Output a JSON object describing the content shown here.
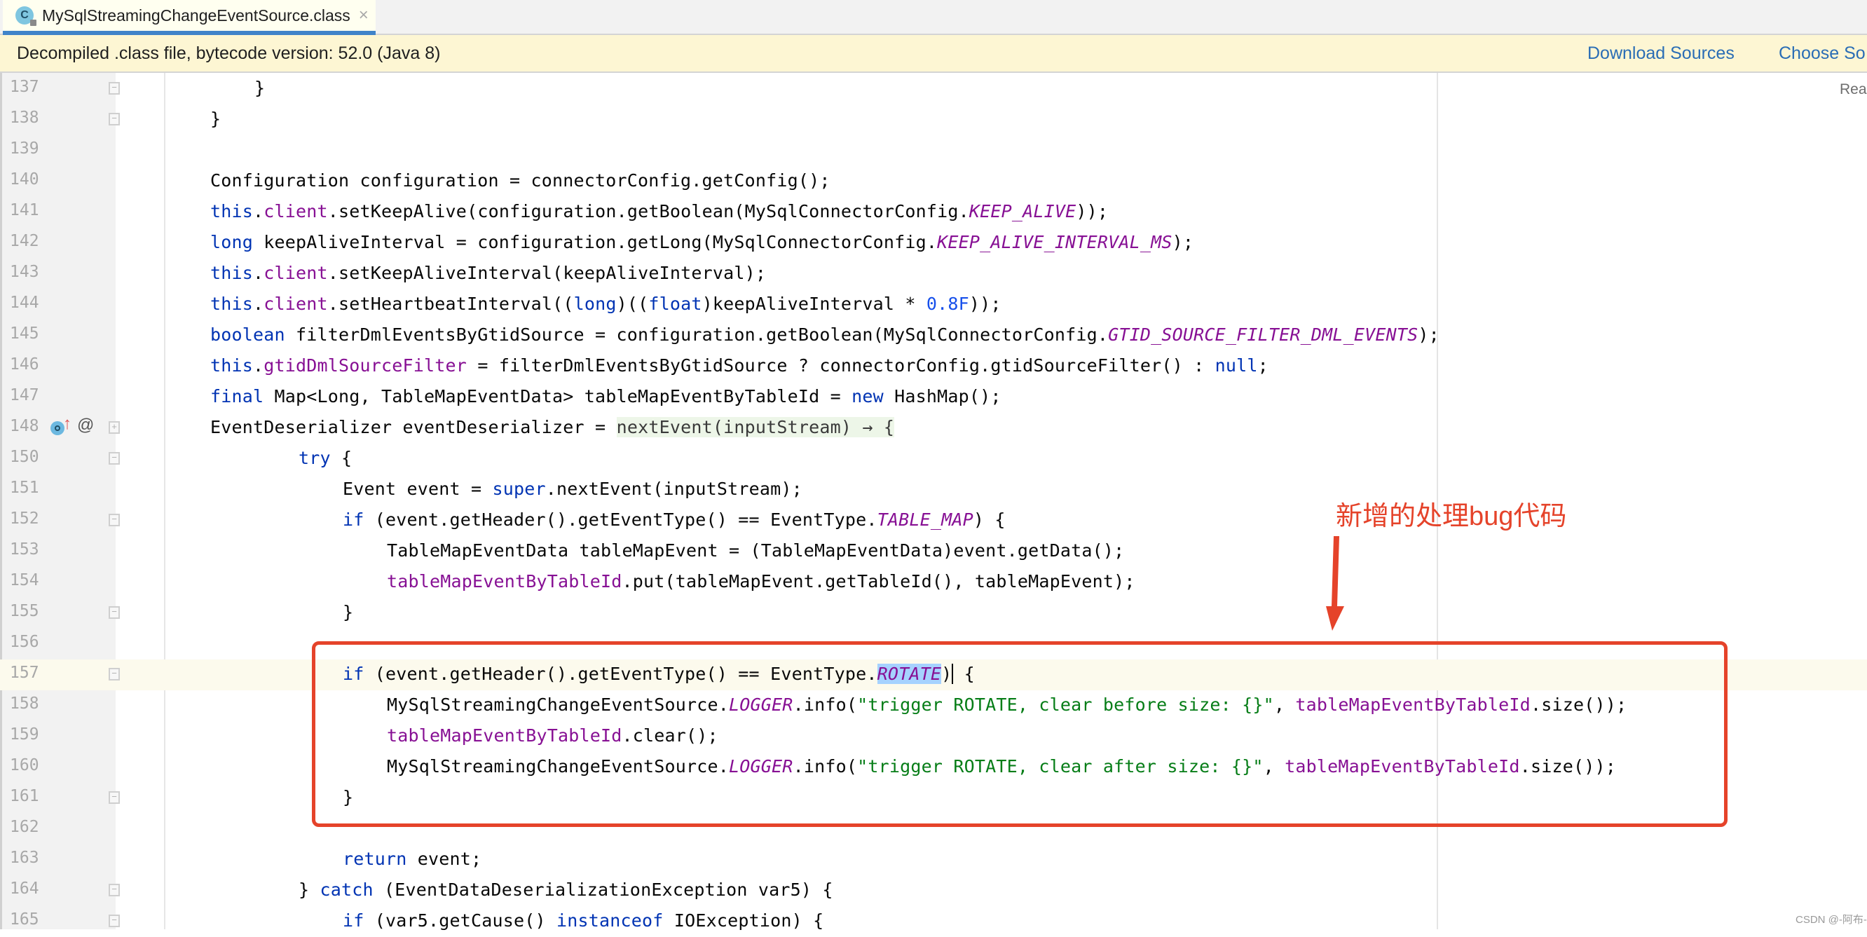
{
  "tab": {
    "icon": "class-file-icon",
    "icon_letter": "C",
    "label": "MySqlStreamingChangeEventSource.class",
    "close_glyph": "×"
  },
  "banner": {
    "text": "Decompiled .class file, bytecode version: 52.0 (Java 8)",
    "download_sources": "Download Sources",
    "choose_sources": "Choose So"
  },
  "reader_mode": "Rea",
  "gutter_icons": {
    "line_148": [
      "implementing-method-icon",
      "override-up-arrow-icon",
      "annotation-at-icon"
    ],
    "at_glyph": "@",
    "up_glyph": "↑"
  },
  "lines": [
    {
      "n": "137",
      "fold": "end",
      "indent": 2,
      "tokens": [
        [
          "}",
          ""
        ]
      ]
    },
    {
      "n": "138",
      "fold": "end",
      "indent": 1,
      "tokens": [
        [
          "}",
          ""
        ]
      ]
    },
    {
      "n": "139",
      "indent": 0,
      "tokens": []
    },
    {
      "n": "140",
      "indent": 1,
      "tokens": [
        [
          "Configuration configuration = connectorConfig.getConfig();",
          ""
        ]
      ]
    },
    {
      "n": "141",
      "indent": 1,
      "tokens": [
        [
          "this",
          "kw"
        ],
        [
          ".",
          ""
        ],
        [
          "client",
          "fld"
        ],
        [
          ".setKeepAlive(configuration.getBoolean(MySqlConnectorConfig.",
          ""
        ],
        [
          "KEEP_ALIVE",
          "cst"
        ],
        [
          "));",
          ""
        ]
      ]
    },
    {
      "n": "142",
      "indent": 1,
      "tokens": [
        [
          "long",
          "kw"
        ],
        [
          " keepAliveInterval = configuration.getLong(MySqlConnectorConfig.",
          ""
        ],
        [
          "KEEP_ALIVE_INTERVAL_MS",
          "cst"
        ],
        [
          ");",
          ""
        ]
      ]
    },
    {
      "n": "143",
      "indent": 1,
      "tokens": [
        [
          "this",
          "kw"
        ],
        [
          ".",
          ""
        ],
        [
          "client",
          "fld"
        ],
        [
          ".setKeepAliveInterval(keepAliveInterval);",
          ""
        ]
      ]
    },
    {
      "n": "144",
      "indent": 1,
      "tokens": [
        [
          "this",
          "kw"
        ],
        [
          ".",
          ""
        ],
        [
          "client",
          "fld"
        ],
        [
          ".setHeartbeatInterval((",
          ""
        ],
        [
          "long",
          "kw"
        ],
        [
          ")((",
          ""
        ],
        [
          "float",
          "kw"
        ],
        [
          ")keepAliveInterval * ",
          ""
        ],
        [
          "0.8F",
          "num"
        ],
        [
          "));",
          ""
        ]
      ]
    },
    {
      "n": "145",
      "indent": 1,
      "tokens": [
        [
          "boolean",
          "kw"
        ],
        [
          " filterDmlEventsByGtidSource = configuration.getBoolean(MySqlConnectorConfig.",
          ""
        ],
        [
          "GTID_SOURCE_FILTER_DML_EVENTS",
          "cst"
        ],
        [
          ");",
          ""
        ]
      ]
    },
    {
      "n": "146",
      "indent": 1,
      "tokens": [
        [
          "this",
          "kw"
        ],
        [
          ".",
          ""
        ],
        [
          "gtidDmlSourceFilter",
          "fld"
        ],
        [
          " = filterDmlEventsByGtidSource ? connectorConfig.gtidSourceFilter() : ",
          ""
        ],
        [
          "null",
          "kw"
        ],
        [
          ";",
          ""
        ]
      ]
    },
    {
      "n": "147",
      "indent": 1,
      "tokens": [
        [
          "final",
          "kw"
        ],
        [
          " Map<Long, TableMapEventData> tableMapEventByTableId = ",
          ""
        ],
        [
          "new",
          "kw"
        ],
        [
          " HashMap();",
          ""
        ]
      ]
    },
    {
      "n": "148",
      "fold": "collapsed",
      "gicons": true,
      "indent": 1,
      "tokens": [
        [
          "EventDeserializer eventDeserializer = ",
          ""
        ],
        [
          "nextEvent(inputStream) → {",
          "lam"
        ]
      ]
    },
    {
      "n": "150",
      "fold": "start",
      "indent": 3,
      "tokens": [
        [
          "try",
          "kw"
        ],
        [
          " {",
          ""
        ]
      ]
    },
    {
      "n": "151",
      "indent": 4,
      "tokens": [
        [
          "Event event = ",
          ""
        ],
        [
          "super",
          "kw"
        ],
        [
          ".nextEvent(inputStream);",
          ""
        ]
      ]
    },
    {
      "n": "152",
      "fold": "start",
      "indent": 4,
      "tokens": [
        [
          "if",
          "kw"
        ],
        [
          " (event.getHeader().getEventType() == EventType.",
          ""
        ],
        [
          "TABLE_MAP",
          "cst"
        ],
        [
          ") {",
          ""
        ]
      ]
    },
    {
      "n": "153",
      "indent": 5,
      "tokens": [
        [
          "TableMapEventData tableMapEvent = (TableMapEventData)event.getData();",
          ""
        ]
      ]
    },
    {
      "n": "154",
      "indent": 5,
      "tokens": [
        [
          "tableMapEventByTableId",
          "fld"
        ],
        [
          ".put(tableMapEvent.getTableId(), tableMapEvent);",
          ""
        ]
      ]
    },
    {
      "n": "155",
      "fold": "end",
      "indent": 4,
      "tokens": [
        [
          "}",
          ""
        ]
      ]
    },
    {
      "n": "156",
      "indent": 0,
      "tokens": []
    },
    {
      "n": "157",
      "fold": "start",
      "current": true,
      "indent": 4,
      "tokens": [
        [
          "if",
          "kw"
        ],
        [
          " (event.getHeader().getEventType() == EventType.",
          ""
        ],
        [
          "ROTATE",
          "cst sel"
        ],
        [
          ")",
          "caret"
        ],
        [
          " {",
          ""
        ]
      ]
    },
    {
      "n": "158",
      "indent": 5,
      "tokens": [
        [
          "MySqlStreamingChangeEventSource.",
          ""
        ],
        [
          "LOGGER",
          "cst"
        ],
        [
          ".info(",
          ""
        ],
        [
          "\"trigger ROTATE, clear before size: {}\"",
          "str"
        ],
        [
          ", ",
          ""
        ],
        [
          "tableMapEventByTableId",
          "fld"
        ],
        [
          ".size());",
          ""
        ]
      ]
    },
    {
      "n": "159",
      "indent": 5,
      "tokens": [
        [
          "tableMapEventByTableId",
          "fld"
        ],
        [
          ".clear();",
          ""
        ]
      ]
    },
    {
      "n": "160",
      "indent": 5,
      "tokens": [
        [
          "MySqlStreamingChangeEventSource.",
          ""
        ],
        [
          "LOGGER",
          "cst"
        ],
        [
          ".info(",
          ""
        ],
        [
          "\"trigger ROTATE, clear after size: {}\"",
          "str"
        ],
        [
          ", ",
          ""
        ],
        [
          "tableMapEventByTableId",
          "fld"
        ],
        [
          ".size());",
          ""
        ]
      ]
    },
    {
      "n": "161",
      "fold": "end",
      "indent": 4,
      "tokens": [
        [
          "}",
          ""
        ]
      ]
    },
    {
      "n": "162",
      "indent": 0,
      "tokens": []
    },
    {
      "n": "163",
      "indent": 4,
      "tokens": [
        [
          "return",
          "kw"
        ],
        [
          " event;",
          ""
        ]
      ]
    },
    {
      "n": "164",
      "fold": "end",
      "indent": 3,
      "tokens": [
        [
          "} ",
          ""
        ],
        [
          "catch",
          "kw"
        ],
        [
          " (EventDataDeserializationException var5) {",
          ""
        ]
      ]
    },
    {
      "n": "165",
      "fold": "start",
      "indent": 4,
      "tokens": [
        [
          "if",
          "kw"
        ],
        [
          " (var5.getCause() ",
          ""
        ],
        [
          "instanceof",
          "kw"
        ],
        [
          " IOException) {",
          ""
        ]
      ]
    }
  ],
  "annotation": {
    "text": "新增的处理bug代码",
    "color": "#e5432a"
  },
  "watermark": "CSDN @-阿布-"
}
